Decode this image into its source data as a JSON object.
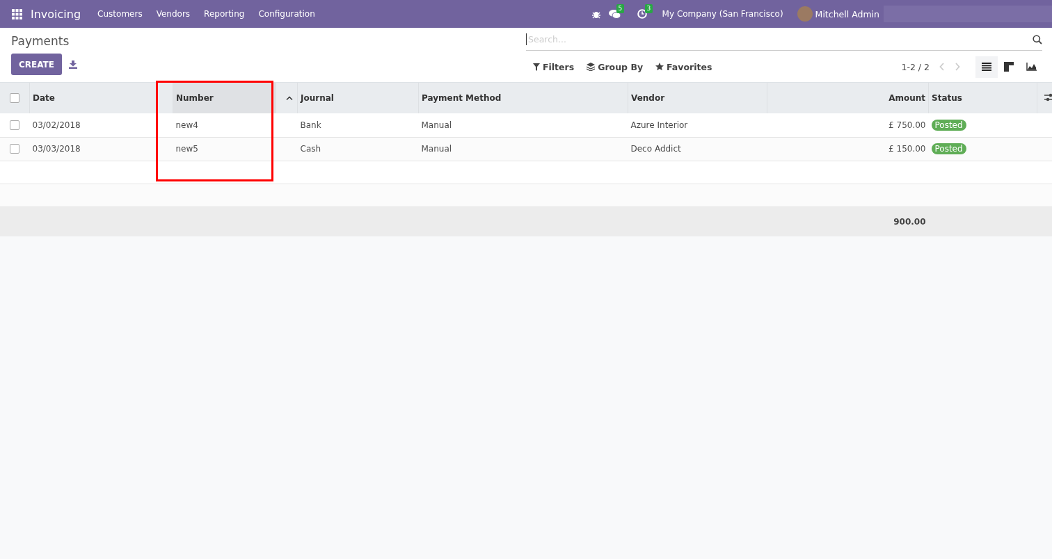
{
  "navbar": {
    "app": "Invoicing",
    "menu": [
      "Customers",
      "Vendors",
      "Reporting",
      "Configuration"
    ],
    "messages_count": "5",
    "activities_count": "3",
    "company": "My Company (San Francisco)",
    "user": "Mitchell Admin"
  },
  "title": "Payments",
  "create_button": "CREATE",
  "search": {
    "placeholder": "Search..."
  },
  "filters": [
    {
      "kind": "filter",
      "label": "Filters"
    },
    {
      "kind": "group",
      "label": "Group By"
    },
    {
      "kind": "star",
      "label": "Favorites"
    }
  ],
  "pager": "1-2 / 2",
  "views": [
    {
      "kind": "list",
      "selected": true
    },
    {
      "kind": "kanban",
      "selected": false
    },
    {
      "kind": "graph",
      "selected": false
    }
  ],
  "table": {
    "select_all": {
      "checked": false
    },
    "columns": [
      {
        "label": "Date",
        "sorted": false
      },
      {
        "label": "Number",
        "sorted": true
      },
      {
        "label": "Journal",
        "sorted": false
      },
      {
        "label": "Payment Method",
        "sorted": false
      },
      {
        "label": "Vendor",
        "sorted": false
      },
      {
        "label": "Amount",
        "sorted": false
      },
      {
        "label": "Status",
        "sorted": false
      }
    ],
    "rows": [
      {
        "checked": false,
        "cells": [
          "03/02/2018",
          "new4",
          "Bank",
          "Manual",
          "Azure Interior",
          "£ 750.00"
        ],
        "status": "Posted"
      },
      {
        "checked": false,
        "cells": [
          "03/03/2018",
          "new5",
          "Cash",
          "Manual",
          "Deco Addict",
          "£ 150.00"
        ],
        "status": "Posted"
      }
    ],
    "total": "900.00"
  }
}
